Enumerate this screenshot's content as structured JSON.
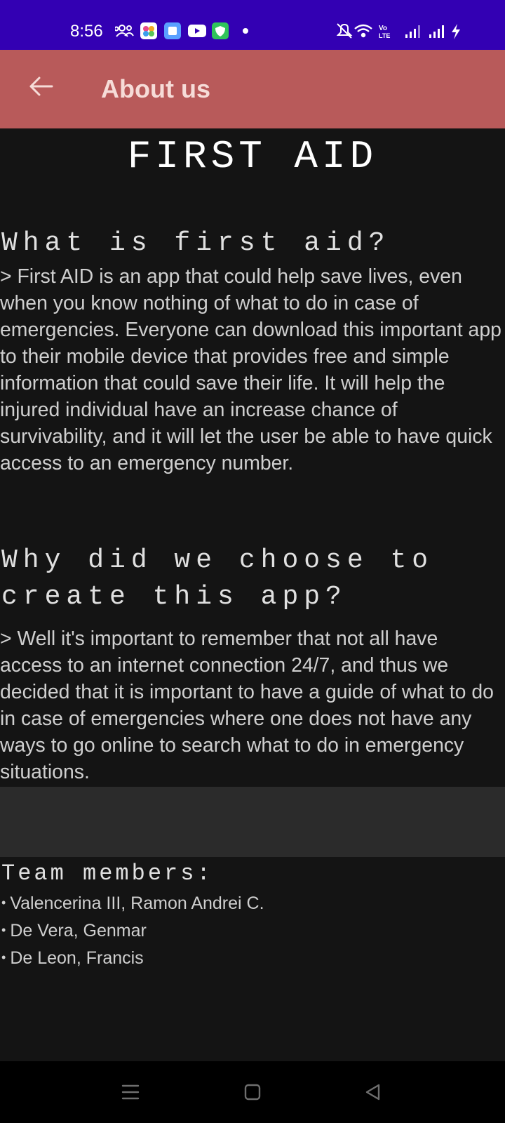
{
  "status_bar": {
    "time": "8:56",
    "left_icons": [
      "people-icon",
      "photos-app-icon",
      "files-app-icon",
      "youtube-icon",
      "shield-app-icon",
      "dot-icon"
    ],
    "right_icons": [
      "mute-bell-icon",
      "wifi-icon",
      "volte-icon",
      "signal-icon",
      "signal-icon",
      "charging-icon"
    ],
    "volte_text": "Vo LTE",
    "background_color": "#3300b3"
  },
  "app_bar": {
    "title": "About us",
    "back_icon": "arrow-left-icon",
    "background_color": "#b85a5a"
  },
  "main": {
    "title": "FIRST AID",
    "section1": {
      "heading": "What is first aid?",
      "body": " > First AID is an app that could help save lives, even when you know nothing of what to do in case of emergencies. Everyone can download this important app to their mobile device that provides free and simple information that could save their life. It will help the injured individual have an increase chance of survivability, and it will let the user be able to have quick access to an emergency number."
    },
    "section2": {
      "heading": "Why did we choose to create this app?",
      "body": " > Well it's important to remember that not all have access to an internet connection 24/7, and thus we decided that it is important to have a guide of what to do in case of emergencies where one does not have any ways to go online to search what to do in emergency situations."
    },
    "team": {
      "heading": "Team members:",
      "members": [
        {
          "bullet": "•",
          "name": "Valencerina III, Ramon Andrei C."
        },
        {
          "bullet": "•",
          "name": "De Vera, Genmar"
        },
        {
          "bullet": "•",
          "name": "De Leon, Francis"
        }
      ]
    }
  },
  "nav_bar": {
    "icons": [
      "menu-icon",
      "home-square-icon",
      "back-triangle-icon"
    ]
  }
}
